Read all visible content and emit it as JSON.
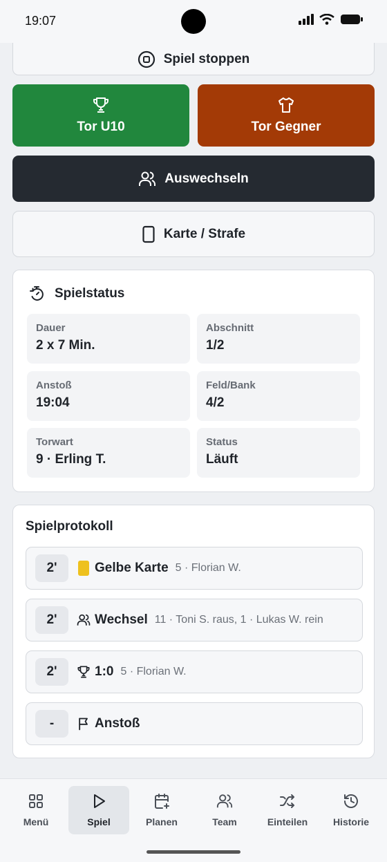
{
  "status_bar": {
    "time": "19:07"
  },
  "actions": {
    "stop": "Spiel stoppen",
    "goal_home": "Tor U10",
    "goal_opponent": "Tor Gegner",
    "substitute": "Auswechseln",
    "card": "Karte / Strafe"
  },
  "colors": {
    "goal_home": "#21873d",
    "goal_opponent": "#a33a06",
    "substitute": "#252a31",
    "yellow_card": "#eec11e"
  },
  "status": {
    "title": "Spielstatus",
    "tiles": [
      {
        "label": "Dauer",
        "value": "2 x 7 Min."
      },
      {
        "label": "Abschnitt",
        "value": "1/2"
      },
      {
        "label": "Anstoß",
        "value": "19:04"
      },
      {
        "label": "Feld/Bank",
        "value": "4/2"
      },
      {
        "label": "Torwart",
        "value": "9 · Erling T."
      },
      {
        "label": "Status",
        "value": "Läuft"
      }
    ]
  },
  "protocol": {
    "title": "Spielprotokoll",
    "entries": [
      {
        "minute": "2'",
        "icon": "yellow-card-icon",
        "title": "Gelbe Karte",
        "detail": "5 · Florian W."
      },
      {
        "minute": "2'",
        "icon": "users-icon",
        "title": "Wechsel",
        "detail": "11 · Toni S. raus, 1 · Lukas W. rein"
      },
      {
        "minute": "2'",
        "icon": "trophy-icon",
        "title": "1:0",
        "detail": "5 · Florian W."
      },
      {
        "minute": "-",
        "icon": "flag-icon",
        "title": "Anstoß",
        "detail": ""
      }
    ]
  },
  "nav": {
    "items": [
      {
        "label": "Menü",
        "icon": "grid-icon"
      },
      {
        "label": "Spiel",
        "icon": "play-icon",
        "active": true
      },
      {
        "label": "Planen",
        "icon": "calendar-plus-icon"
      },
      {
        "label": "Team",
        "icon": "users-icon"
      },
      {
        "label": "Einteilen",
        "icon": "shuffle-icon"
      },
      {
        "label": "Historie",
        "icon": "history-icon"
      }
    ]
  }
}
